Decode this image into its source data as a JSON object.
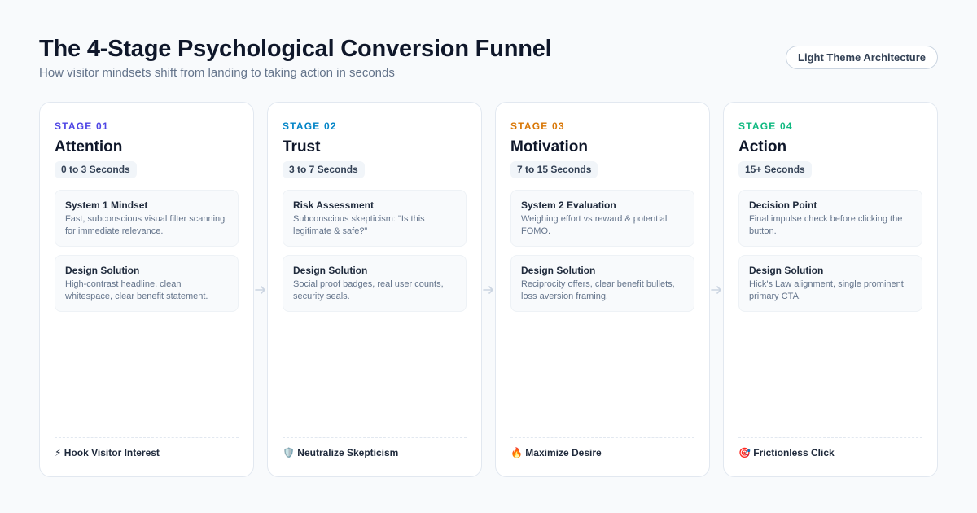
{
  "header": {
    "title": "The 4-Stage Psychological Conversion Funnel",
    "subtitle": "How visitor mindsets shift from landing to taking action in seconds",
    "theme_badge": "Light Theme Architecture"
  },
  "colors": {
    "stage_01": "#4f46e5",
    "stage_02": "#0284c7",
    "stage_03": "#d97706",
    "stage_04": "#10b981",
    "arrow": "#cbd5e1"
  },
  "stages": [
    {
      "label": "STAGE 01",
      "title": "Attention",
      "time": "0 to 3 Seconds",
      "box1": {
        "title": "System 1 Mindset",
        "text": "Fast, subconscious visual filter scanning for immediate relevance."
      },
      "box2": {
        "title": "Design Solution",
        "text": "High-contrast headline, clean whitespace, clear benefit statement."
      },
      "footer_icon": "⚡",
      "footer_icon_name": "lightning-icon",
      "footer_text": "Hook Visitor Interest"
    },
    {
      "label": "STAGE 02",
      "title": "Trust",
      "time": "3 to 7 Seconds",
      "box1": {
        "title": "Risk Assessment",
        "text": "Subconscious skepticism: \"Is this legitimate & safe?\""
      },
      "box2": {
        "title": "Design Solution",
        "text": "Social proof badges, real user counts, security seals."
      },
      "footer_icon": "🛡️",
      "footer_icon_name": "shield-icon",
      "footer_text": "Neutralize Skepticism"
    },
    {
      "label": "STAGE 03",
      "title": "Motivation",
      "time": "7 to 15 Seconds",
      "box1": {
        "title": "System 2 Evaluation",
        "text": "Weighing effort vs reward & potential FOMO."
      },
      "box2": {
        "title": "Design Solution",
        "text": "Reciprocity offers, clear benefit bullets, loss aversion framing."
      },
      "footer_icon": "🔥",
      "footer_icon_name": "fire-icon",
      "footer_text": "Maximize Desire"
    },
    {
      "label": "STAGE 04",
      "title": "Action",
      "time": "15+ Seconds",
      "box1": {
        "title": "Decision Point",
        "text": "Final impulse check before clicking the button."
      },
      "box2": {
        "title": "Design Solution",
        "text": "Hick's Law alignment, single prominent primary CTA."
      },
      "footer_icon": "🎯",
      "footer_icon_name": "target-icon",
      "footer_text": "Frictionless Click"
    }
  ]
}
